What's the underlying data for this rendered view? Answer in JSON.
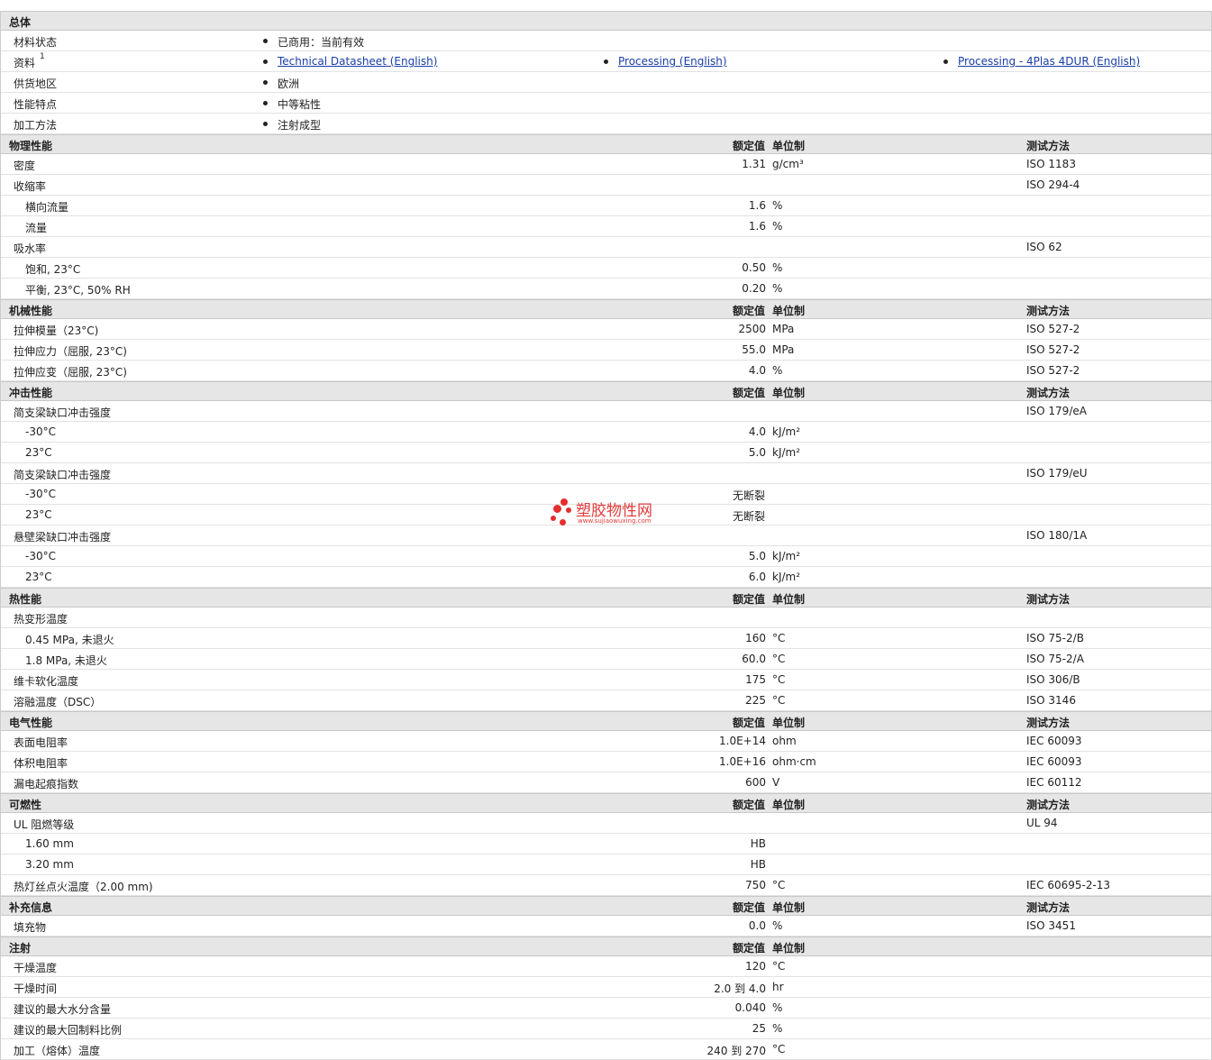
{
  "sections": [
    {
      "title": "总体",
      "head": false,
      "rows": [
        {
          "kind": "info",
          "label": "材料状态",
          "items": [
            {
              "text": "已商用：当前有效"
            }
          ]
        },
        {
          "kind": "info",
          "label": "资料",
          "sup": "1",
          "items": [
            {
              "text": "Technical Datasheet (English)",
              "link": true
            },
            {
              "text": "Processing (English)",
              "link": true
            },
            {
              "text": "Processing - 4Plas 4DUR (English)",
              "link": true
            }
          ]
        },
        {
          "kind": "info",
          "label": "供货地区",
          "items": [
            {
              "text": "欧洲"
            }
          ]
        },
        {
          "kind": "info",
          "label": "性能特点",
          "items": [
            {
              "text": "中等粘性"
            }
          ]
        },
        {
          "kind": "info",
          "label": "加工方法",
          "items": [
            {
              "text": "注射成型"
            }
          ]
        }
      ]
    },
    {
      "title": "物理性能",
      "head": true,
      "rows": [
        {
          "label": "密度",
          "value": "1.31",
          "unit": "g/cm³",
          "method": "ISO 1183"
        },
        {
          "label": "收缩率",
          "method": "ISO 294-4"
        },
        {
          "label": "横向流量",
          "indent": true,
          "value": "1.6",
          "unit": "%"
        },
        {
          "label": "流量",
          "indent": true,
          "value": "1.6",
          "unit": "%"
        },
        {
          "label": "吸水率",
          "method": "ISO 62"
        },
        {
          "label": "饱和, 23°C",
          "indent": true,
          "value": "0.50",
          "unit": "%"
        },
        {
          "label": "平衡, 23°C, 50% RH",
          "indent": true,
          "value": "0.20",
          "unit": "%"
        }
      ]
    },
    {
      "title": "机械性能",
      "head": true,
      "rows": [
        {
          "label": "拉伸模量（23°C)",
          "value": "2500",
          "unit": "MPa",
          "method": "ISO 527-2"
        },
        {
          "label": "拉伸应力（屈服, 23°C)",
          "value": "55.0",
          "unit": "MPa",
          "method": "ISO 527-2"
        },
        {
          "label": "拉伸应变（屈服, 23°C)",
          "value": "4.0",
          "unit": "%",
          "method": "ISO 527-2"
        }
      ]
    },
    {
      "title": "冲击性能",
      "head": true,
      "rows": [
        {
          "label": "简支梁缺口冲击强度",
          "method": "ISO 179/eA"
        },
        {
          "label": "-30°C",
          "indent": true,
          "value": "4.0",
          "unit": "kJ/m²"
        },
        {
          "label": "23°C",
          "indent": true,
          "value": "5.0",
          "unit": "kJ/m²"
        },
        {
          "label": "简支梁缺口冲击强度",
          "method": "ISO 179/eU"
        },
        {
          "label": "-30°C",
          "indent": true,
          "valuec": "无断裂"
        },
        {
          "label": "23°C",
          "indent": true,
          "valuec": "无断裂"
        },
        {
          "label": "悬壁梁缺口冲击强度",
          "method": "ISO 180/1A"
        },
        {
          "label": "-30°C",
          "indent": true,
          "value": "5.0",
          "unit": "kJ/m²"
        },
        {
          "label": "23°C",
          "indent": true,
          "value": "6.0",
          "unit": "kJ/m²"
        }
      ]
    },
    {
      "title": "热性能",
      "head": true,
      "rows": [
        {
          "label": "热变形温度"
        },
        {
          "label": "0.45 MPa, 未退火",
          "indent": true,
          "value": "160",
          "unit": "°C",
          "method": "ISO 75-2/B"
        },
        {
          "label": "1.8 MPa, 未退火",
          "indent": true,
          "value": "60.0",
          "unit": "°C",
          "method": "ISO 75-2/A"
        },
        {
          "label": "维卡软化温度",
          "value": "175",
          "unit": "°C",
          "method": "ISO 306/B"
        },
        {
          "label": "溶融温度（DSC）",
          "value": "225",
          "unit": "°C",
          "method": "ISO 3146"
        }
      ]
    },
    {
      "title": "电气性能",
      "head": true,
      "rows": [
        {
          "label": "表面电阻率",
          "value": "1.0E+14",
          "unit": "ohm",
          "method": "IEC 60093"
        },
        {
          "label": "体积电阻率",
          "value": "1.0E+16",
          "unit": "ohm·cm",
          "method": "IEC 60093"
        },
        {
          "label": "漏电起痕指数",
          "value": "600",
          "unit": "V",
          "method": "IEC 60112"
        }
      ]
    },
    {
      "title": "可燃性",
      "head": true,
      "rows": [
        {
          "label": "UL 阻燃等级",
          "method": "UL 94"
        },
        {
          "label": "1.60 mm",
          "indent": true,
          "value": "HB"
        },
        {
          "label": "3.20 mm",
          "indent": true,
          "value": "HB"
        },
        {
          "label": "热灯丝点火温度（2.00 mm)",
          "value": "750",
          "unit": "°C",
          "method": "IEC 60695-2-13"
        }
      ]
    },
    {
      "title": "补充信息",
      "head": true,
      "rows": [
        {
          "label": "填充物",
          "value": "0.0",
          "unit": "%",
          "method": "ISO 3451"
        }
      ]
    },
    {
      "title": "注射",
      "head": true,
      "nomethod": true,
      "rows": [
        {
          "label": "干燥温度",
          "value": "120",
          "unit": "°C"
        },
        {
          "label": "干燥时间",
          "value": "2.0 到  4.0",
          "unit": "hr"
        },
        {
          "label": "建议的最大水分含量",
          "value": "0.040",
          "unit": "%"
        },
        {
          "label": "建议的最大回制料比例",
          "value": "25",
          "unit": "%"
        },
        {
          "label": "加工（熔体）温度",
          "value": "240 到  270",
          "unit": "°C"
        }
      ]
    }
  ],
  "headers": {
    "value": "额定值",
    "unit": "单位制",
    "method": "测试方法"
  },
  "watermark": {
    "name": "塑胶物性网",
    "url": "www.sujiaowuxing.com",
    "color": "#e52d2d"
  }
}
